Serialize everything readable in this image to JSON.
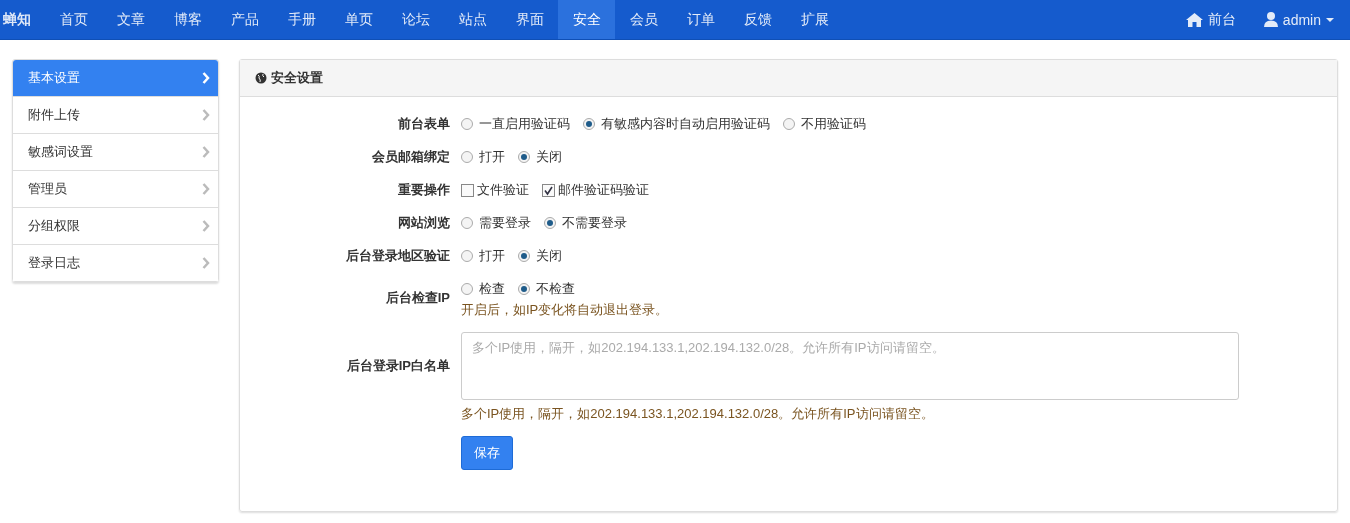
{
  "navbar": {
    "brand": "蝉知",
    "items": [
      {
        "label": "首页",
        "selected": false
      },
      {
        "label": "文章",
        "selected": false
      },
      {
        "label": "博客",
        "selected": false
      },
      {
        "label": "产品",
        "selected": false
      },
      {
        "label": "手册",
        "selected": false
      },
      {
        "label": "单页",
        "selected": false
      },
      {
        "label": "论坛",
        "selected": false
      },
      {
        "label": "站点",
        "selected": false
      },
      {
        "label": "界面",
        "selected": false
      },
      {
        "label": "安全",
        "selected": true
      },
      {
        "label": "会员",
        "selected": false
      },
      {
        "label": "订单",
        "selected": false
      },
      {
        "label": "反馈",
        "selected": false
      },
      {
        "label": "扩展",
        "selected": false
      }
    ],
    "frontend": "前台",
    "user": "admin"
  },
  "sidebar": {
    "items": [
      {
        "label": "基本设置",
        "selected": true
      },
      {
        "label": "附件上传",
        "selected": false
      },
      {
        "label": "敏感词设置",
        "selected": false
      },
      {
        "label": "管理员",
        "selected": false
      },
      {
        "label": "分组权限",
        "selected": false
      },
      {
        "label": "登录日志",
        "selected": false
      }
    ]
  },
  "panel": {
    "title": "安全设置",
    "rows": [
      {
        "kind": "radio",
        "label": "前台表单",
        "options": [
          {
            "label": "一直启用验证码",
            "selected": false
          },
          {
            "label": "有敏感内容时自动启用验证码",
            "selected": true
          },
          {
            "label": "不用验证码",
            "selected": false
          }
        ]
      },
      {
        "kind": "radio",
        "label": "会员邮箱绑定",
        "options": [
          {
            "label": "打开",
            "selected": false
          },
          {
            "label": "关闭",
            "selected": true
          }
        ]
      },
      {
        "kind": "checkbox",
        "label": "重要操作",
        "options": [
          {
            "label": "文件验证",
            "checked": false
          },
          {
            "label": "邮件验证码验证",
            "checked": true
          }
        ]
      },
      {
        "kind": "radio",
        "label": "网站浏览",
        "options": [
          {
            "label": "需要登录",
            "selected": false
          },
          {
            "label": "不需要登录",
            "selected": true
          }
        ]
      },
      {
        "kind": "radio",
        "label": "后台登录地区验证",
        "options": [
          {
            "label": "打开",
            "selected": false
          },
          {
            "label": "关闭",
            "selected": true
          }
        ]
      },
      {
        "kind": "radio",
        "label": "后台检查IP",
        "options": [
          {
            "label": "检查",
            "selected": false
          },
          {
            "label": "不检查",
            "selected": true
          }
        ],
        "help": "开启后，如IP变化将自动退出登录。"
      },
      {
        "kind": "textarea",
        "label": "后台登录IP白名单",
        "placeholder": "多个IP使用，隔开，如202.194.133.1,202.194.132.0/28。允许所有IP访问请留空。",
        "help": "多个IP使用，隔开，如202.194.133.1,202.194.132.0/28。允许所有IP访问请留空。"
      }
    ],
    "save": "保存"
  }
}
